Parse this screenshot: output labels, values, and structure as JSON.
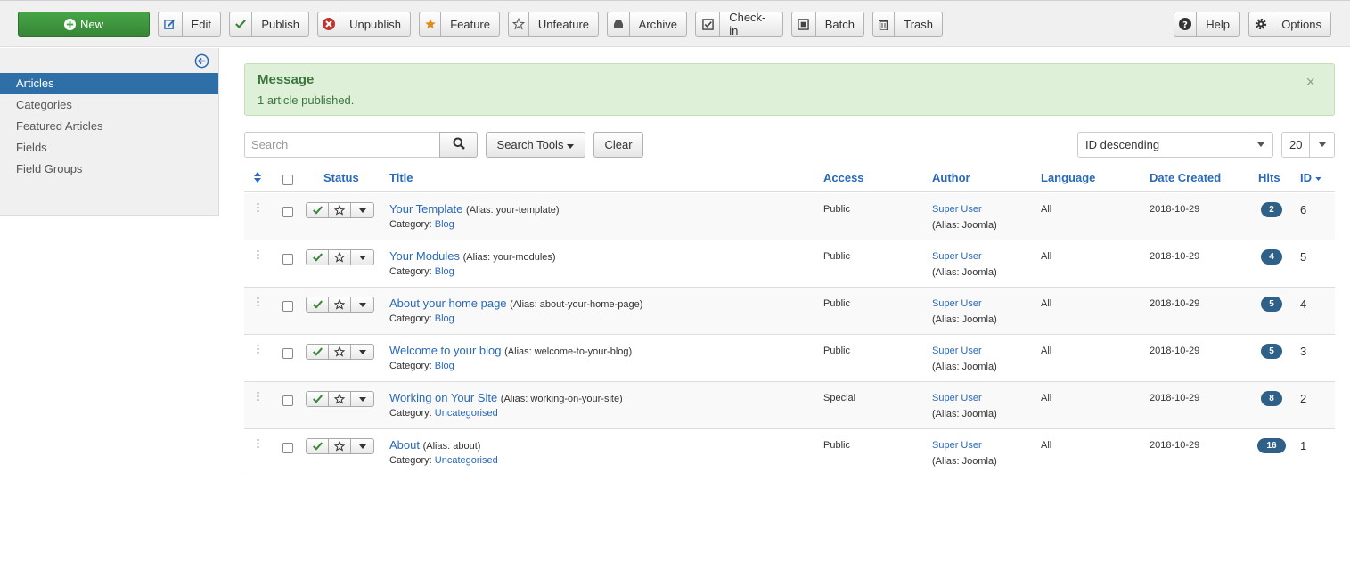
{
  "toolbar": {
    "new": "New",
    "edit": "Edit",
    "publish": "Publish",
    "unpublish": "Unpublish",
    "feature": "Feature",
    "unfeature": "Unfeature",
    "archive": "Archive",
    "checkin": "Check-in",
    "batch": "Batch",
    "trash": "Trash",
    "help": "Help",
    "options": "Options"
  },
  "sidebar": {
    "items": [
      {
        "label": "Articles",
        "active": true
      },
      {
        "label": "Categories"
      },
      {
        "label": "Featured Articles"
      },
      {
        "label": "Fields"
      },
      {
        "label": "Field Groups"
      }
    ]
  },
  "message": {
    "title": "Message",
    "body": "1 article published.",
    "close": "×"
  },
  "filters": {
    "search_placeholder": "Search",
    "search_tools": "Search Tools",
    "clear": "Clear",
    "ordering": "ID descending",
    "limit": "20"
  },
  "table": {
    "headers": {
      "status": "Status",
      "title": "Title",
      "access": "Access",
      "author": "Author",
      "language": "Language",
      "date": "Date Created",
      "hits": "Hits",
      "id": "ID"
    },
    "category_label": "Category:",
    "rows": [
      {
        "title": "Your Template",
        "alias": "(Alias: your-template)",
        "category": "Blog",
        "access": "Public",
        "author": "Super User",
        "author_alias": "(Alias: Joomla)",
        "language": "All",
        "date": "2018-10-29",
        "hits": "2",
        "id": "6"
      },
      {
        "title": "Your Modules",
        "alias": "(Alias: your-modules)",
        "category": "Blog",
        "access": "Public",
        "author": "Super User",
        "author_alias": "(Alias: Joomla)",
        "language": "All",
        "date": "2018-10-29",
        "hits": "4",
        "id": "5"
      },
      {
        "title": "About your home page",
        "alias": "(Alias: about-your-home-page)",
        "category": "Blog",
        "access": "Public",
        "author": "Super User",
        "author_alias": "(Alias: Joomla)",
        "language": "All",
        "date": "2018-10-29",
        "hits": "5",
        "id": "4"
      },
      {
        "title": "Welcome to your blog",
        "alias": "(Alias: welcome-to-your-blog)",
        "category": "Blog",
        "access": "Public",
        "author": "Super User",
        "author_alias": "(Alias: Joomla)",
        "language": "All",
        "date": "2018-10-29",
        "hits": "5",
        "id": "3"
      },
      {
        "title": "Working on Your Site",
        "alias": "(Alias: working-on-your-site)",
        "category": "Uncategorised",
        "access": "Special",
        "author": "Super User",
        "author_alias": "(Alias: Joomla)",
        "language": "All",
        "date": "2018-10-29",
        "hits": "8",
        "id": "2"
      },
      {
        "title": "About",
        "alias": "(Alias: about)",
        "category": "Uncategorised",
        "access": "Public",
        "author": "Super User",
        "author_alias": "(Alias: Joomla)",
        "language": "All",
        "date": "2018-10-29",
        "hits": "16",
        "id": "1"
      }
    ]
  },
  "colors": {
    "brand_green": "#46a546",
    "sidebar_active": "#2f6fa7",
    "link": "#2a69b8",
    "alert_bg": "#dff0d8",
    "badge": "#2e6088"
  }
}
